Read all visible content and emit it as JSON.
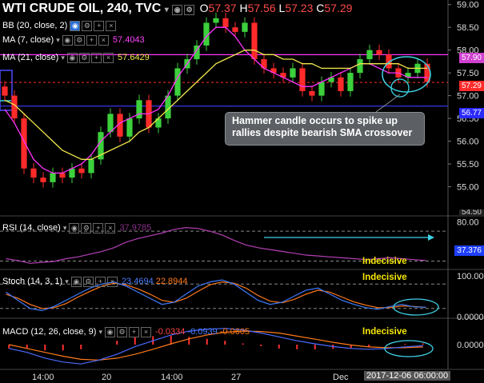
{
  "header": {
    "symbol": "WTI CRUDE OIL, 240, TVC",
    "open_label": "O",
    "open": "57.37",
    "high_label": "H",
    "high": "57.56",
    "low_label": "L",
    "low": "57.23",
    "close_label": "C",
    "close": "57.29"
  },
  "indicators": {
    "bb": "BB (20, close, 2)",
    "ma7": "MA (7, close)",
    "ma7_value": "57.4043",
    "ma21": "MA (21, close)",
    "ma21_value": "57.6429"
  },
  "annotation": "Hammer candle occurs to spike up rallies despite bearish SMA crossover",
  "panels": {
    "rsi": {
      "label": "RSI (14, close)",
      "value": "37.9785",
      "note": "Indecisive"
    },
    "stoch": {
      "label": "Stoch (14, 3, 1)",
      "k": "23.4694",
      "d": "22.8944",
      "note": "Indecisive"
    },
    "macd": {
      "label": "MACD (12, 26, close, 9)",
      "v1": "-0.0334",
      "v2": "-0.0939",
      "v3": "-0.0605",
      "note": "Indecisive"
    }
  },
  "right_badges": {
    "ma21": "57.90",
    "last": "57.29",
    "level": "56.77",
    "cut": "54.50",
    "rsi_level": "37.376"
  },
  "x_labels": [
    "14:00",
    "20",
    "14:00",
    "27",
    "Dec"
  ],
  "cursor_time": "2017-12-06 06:00:00",
  "colors": {
    "up": "#3cd13c",
    "down": "#ff2a2a",
    "ma7": "#ff33ff",
    "ma21": "#f2e84b",
    "bb": "#c061c0",
    "level": "#3d3dff",
    "rsi": "#b640b6",
    "stoch_k": "#3e7cff",
    "stoch_d": "#ff7a1a",
    "macd": "#4a6bff",
    "signal": "#ff7a1a",
    "hist": "#ff3030",
    "callout": "#5c6065",
    "circle": "#3fd2e6"
  },
  "chart_data": [
    {
      "type": "line",
      "title": "WTI CRUDE OIL, 240, TVC",
      "ylim": [
        54.5,
        59.1
      ],
      "y_ticks": [
        55.0,
        55.5,
        56.0,
        56.5,
        57.0,
        57.5,
        58.0,
        58.5,
        59.0
      ],
      "y_tick_labels": [
        "55.00",
        "55.50",
        "56.00",
        "56.50",
        "57.00",
        "57.50",
        "58.00",
        "58.50",
        "59.00"
      ],
      "series": [
        {
          "name": "Close",
          "values": [
            57.0,
            56.5,
            55.4,
            55.2,
            55.1,
            55.3,
            55.2,
            55.4,
            55.3,
            55.6,
            56.2,
            56.6,
            56.1,
            56.5,
            56.9,
            56.3,
            56.5,
            57.0,
            57.6,
            57.8,
            58.1,
            58.6,
            58.7,
            58.5,
            58.4,
            58.6,
            57.8,
            57.6,
            57.5,
            57.4,
            57.6,
            57.1,
            57.0,
            57.3,
            57.4,
            57.1,
            57.5,
            57.8,
            58.0,
            57.9,
            57.6,
            57.4,
            57.5,
            57.7,
            57.3
          ]
        },
        {
          "name": "MA (7, close)",
          "values": [
            56.7,
            56.4,
            56.0,
            55.6,
            55.4,
            55.3,
            55.3,
            55.4,
            55.5,
            55.7,
            56.0,
            56.2,
            56.4,
            56.5,
            56.6,
            56.6,
            56.7,
            57.0,
            57.4,
            57.7,
            58.0,
            58.3,
            58.5,
            58.5,
            58.3,
            58.0,
            57.8,
            57.6,
            57.5,
            57.4,
            57.3,
            57.2,
            57.2,
            57.3,
            57.4,
            57.5,
            57.6,
            57.7,
            57.7,
            57.6,
            57.5,
            57.5,
            57.4,
            57.4,
            57.4
          ]
        },
        {
          "name": "MA (21, close)",
          "values": [
            56.9,
            56.8,
            56.6,
            56.4,
            56.2,
            56.0,
            55.8,
            55.7,
            55.6,
            55.6,
            55.7,
            55.8,
            55.9,
            56.0,
            56.2,
            56.3,
            56.5,
            56.7,
            56.9,
            57.1,
            57.3,
            57.5,
            57.7,
            57.8,
            57.9,
            58.0,
            58.0,
            57.9,
            57.9,
            57.8,
            57.8,
            57.7,
            57.7,
            57.6,
            57.6,
            57.6,
            57.6,
            57.7,
            57.7,
            57.7,
            57.7,
            57.7,
            57.6,
            57.6,
            57.6
          ]
        }
      ],
      "levels": [
        57.9,
        57.29,
        56.77
      ]
    },
    {
      "type": "line",
      "title": "RSI (14, close)",
      "ylim": [
        30,
        85
      ],
      "y_ticks": [
        80.0
      ],
      "y_tick_labels": [
        "80.00"
      ],
      "series": [
        {
          "name": "RSI (14, close)",
          "values": [
            40,
            38,
            35,
            36,
            37,
            40,
            42,
            45,
            48,
            52,
            58,
            62,
            65,
            68,
            72,
            74,
            73,
            70,
            66,
            60,
            55,
            52,
            50,
            48,
            46,
            44,
            43,
            42,
            41,
            40,
            39,
            40,
            41,
            40,
            39,
            38
          ]
        }
      ]
    },
    {
      "type": "line",
      "title": "Stoch (14, 3, 1)",
      "ylim": [
        0,
        100
      ],
      "y_ticks": [
        0,
        100
      ],
      "y_tick_labels": [
        "0.0000",
        "100.00"
      ],
      "series": [
        {
          "name": "%K",
          "values": [
            60,
            40,
            20,
            15,
            25,
            40,
            55,
            70,
            80,
            85,
            75,
            60,
            45,
            30,
            35,
            55,
            75,
            85,
            90,
            80,
            60,
            40,
            30,
            35,
            50,
            65,
            70,
            55,
            40,
            30,
            22,
            18,
            25,
            30,
            24,
            23
          ]
        },
        {
          "name": "%D",
          "values": [
            55,
            45,
            30,
            20,
            22,
            32,
            48,
            62,
            75,
            82,
            78,
            68,
            55,
            40,
            35,
            45,
            62,
            78,
            85,
            82,
            70,
            52,
            38,
            34,
            42,
            55,
            65,
            60,
            48,
            36,
            28,
            22,
            22,
            26,
            25,
            23
          ]
        }
      ]
    },
    {
      "type": "bar",
      "title": "MACD (12, 26, close, 9)",
      "ylim": [
        -0.6,
        0.6
      ],
      "y_ticks": [
        0.0
      ],
      "y_tick_labels": [
        "0.0000"
      ],
      "series": [
        {
          "name": "MACD",
          "values": [
            -0.1,
            -0.2,
            -0.35,
            -0.45,
            -0.5,
            -0.4,
            -0.25,
            -0.05,
            0.1,
            0.25,
            0.35,
            0.4,
            0.42,
            0.38,
            0.3,
            0.2,
            0.1,
            0.02,
            -0.05,
            -0.1,
            -0.12,
            -0.1,
            -0.06,
            -0.03
          ]
        },
        {
          "name": "Signal",
          "values": [
            0.0,
            -0.1,
            -0.2,
            -0.3,
            -0.38,
            -0.4,
            -0.35,
            -0.25,
            -0.12,
            0.02,
            0.15,
            0.25,
            0.32,
            0.35,
            0.34,
            0.3,
            0.22,
            0.14,
            0.06,
            -0.01,
            -0.06,
            -0.08,
            -0.08,
            -0.06
          ]
        }
      ]
    }
  ]
}
